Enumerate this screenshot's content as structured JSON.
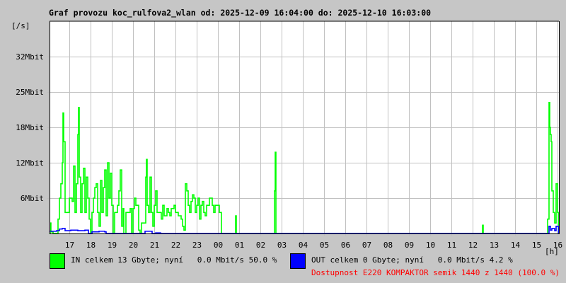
{
  "chart_data": {
    "type": "line",
    "title": "Graf provozu koc_rulfova2_wlan od: 2025-12-09 16:04:00 do: 2025-12-10 16:03:00",
    "ylabel": "[/s]",
    "xlabel": "[h]",
    "start": "2025-12-09 16:04",
    "end": "2025-12-10 16:03",
    "ylim_mbit": [
      0,
      38.4
    ],
    "y_ticks": [
      {
        "value": 6.4,
        "label": "6Mbit"
      },
      {
        "value": 12.8,
        "label": "12Mbit"
      },
      {
        "value": 19.2,
        "label": "18Mbit"
      },
      {
        "value": 25.6,
        "label": "25Mbit"
      },
      {
        "value": 32,
        "label": "32Mbit"
      }
    ],
    "x_ticks": [
      "17",
      "18",
      "19",
      "20",
      "21",
      "22",
      "23",
      "00",
      "01",
      "02",
      "03",
      "04",
      "05",
      "06",
      "07",
      "08",
      "09",
      "10",
      "11",
      "12",
      "13",
      "14",
      "15",
      "16"
    ],
    "grid": true,
    "series": [
      {
        "name": "IN",
        "color": "#00ff00",
        "points": [
          [
            "16:04",
            0
          ],
          [
            "16:06",
            1.9
          ],
          [
            "16:08",
            0.3
          ],
          [
            "16:14",
            0
          ],
          [
            "16:24",
            0
          ],
          [
            "16:28",
            2.6
          ],
          [
            "16:32",
            6.4
          ],
          [
            "16:36",
            9.0
          ],
          [
            "16:40",
            12.8
          ],
          [
            "16:42",
            21.8
          ],
          [
            "16:44",
            16.6
          ],
          [
            "16:48",
            3.8
          ],
          [
            "16:54",
            3.8
          ],
          [
            "17:00",
            6.4
          ],
          [
            "17:08",
            5.8
          ],
          [
            "17:12",
            12.2
          ],
          [
            "17:16",
            3.8
          ],
          [
            "17:20",
            9.0
          ],
          [
            "17:24",
            17.9
          ],
          [
            "17:26",
            22.8
          ],
          [
            "17:28",
            10.2
          ],
          [
            "17:32",
            3.8
          ],
          [
            "17:36",
            9.0
          ],
          [
            "17:40",
            11.8
          ],
          [
            "17:44",
            3.8
          ],
          [
            "17:48",
            10.2
          ],
          [
            "17:52",
            6.4
          ],
          [
            "17:56",
            2.6
          ],
          [
            "18:00",
            0
          ],
          [
            "18:04",
            3.8
          ],
          [
            "18:08",
            6.4
          ],
          [
            "18:12",
            8.3
          ],
          [
            "18:16",
            9.0
          ],
          [
            "18:20",
            3.8
          ],
          [
            "18:24",
            1.3
          ],
          [
            "18:28",
            9.6
          ],
          [
            "18:32",
            3.8
          ],
          [
            "18:36",
            8.3
          ],
          [
            "18:40",
            11.5
          ],
          [
            "18:44",
            3.2
          ],
          [
            "18:48",
            12.8
          ],
          [
            "18:52",
            6.4
          ],
          [
            "18:56",
            10.9
          ],
          [
            "19:00",
            5.1
          ],
          [
            "19:04",
            0
          ],
          [
            "19:08",
            3.8
          ],
          [
            "19:16",
            5.1
          ],
          [
            "19:20",
            7.7
          ],
          [
            "19:24",
            11.5
          ],
          [
            "19:28",
            1.3
          ],
          [
            "19:32",
            4.5
          ],
          [
            "19:34",
            0
          ],
          [
            "19:40",
            3.8
          ],
          [
            "19:48",
            3.8
          ],
          [
            "19:52",
            4.5
          ],
          [
            "19:56",
            0
          ],
          [
            "20:00",
            4.5
          ],
          [
            "20:04",
            6.4
          ],
          [
            "20:08",
            5.1
          ],
          [
            "20:16",
            0.6
          ],
          [
            "20:20",
            0
          ],
          [
            "20:24",
            1.9
          ],
          [
            "20:32",
            1.9
          ],
          [
            "20:36",
            10.2
          ],
          [
            "20:38",
            13.4
          ],
          [
            "20:40",
            5.1
          ],
          [
            "20:44",
            3.8
          ],
          [
            "20:48",
            10.2
          ],
          [
            "20:52",
            3.8
          ],
          [
            "20:56",
            1.3
          ],
          [
            "21:00",
            5.1
          ],
          [
            "21:04",
            7.7
          ],
          [
            "21:08",
            3.8
          ],
          [
            "21:12",
            3.8
          ],
          [
            "21:20",
            2.6
          ],
          [
            "21:24",
            5.1
          ],
          [
            "21:28",
            3.2
          ],
          [
            "21:36",
            4.5
          ],
          [
            "21:40",
            3.8
          ],
          [
            "21:44",
            3.2
          ],
          [
            "21:48",
            4.5
          ],
          [
            "21:56",
            5.1
          ],
          [
            "22:00",
            3.8
          ],
          [
            "22:08",
            3.2
          ],
          [
            "22:16",
            2.6
          ],
          [
            "22:20",
            1.3
          ],
          [
            "22:24",
            0.6
          ],
          [
            "22:28",
            9.0
          ],
          [
            "22:32",
            7.7
          ],
          [
            "22:36",
            5.1
          ],
          [
            "22:40",
            3.8
          ],
          [
            "22:44",
            5.8
          ],
          [
            "22:48",
            7.0
          ],
          [
            "22:52",
            6.4
          ],
          [
            "22:56",
            3.8
          ],
          [
            "23:00",
            5.1
          ],
          [
            "23:04",
            6.4
          ],
          [
            "23:08",
            2.6
          ],
          [
            "23:12",
            5.1
          ],
          [
            "23:16",
            5.8
          ],
          [
            "23:20",
            3.8
          ],
          [
            "23:24",
            3.2
          ],
          [
            "23:28",
            5.1
          ],
          [
            "23:36",
            6.4
          ],
          [
            "23:44",
            5.1
          ],
          [
            "23:48",
            3.8
          ],
          [
            "23:52",
            5.1
          ],
          [
            "23:56",
            5.1
          ],
          [
            "00:00",
            5.1
          ],
          [
            "00:04",
            3.8
          ],
          [
            "00:08",
            3.8
          ],
          [
            "00:10",
            0
          ],
          [
            "00:14",
            0
          ],
          [
            "00:44",
            0
          ],
          [
            "00:50",
            3.2
          ],
          [
            "00:52",
            0
          ],
          [
            "00:54",
            0
          ],
          [
            "02:36",
            0
          ],
          [
            "02:40",
            7.7
          ],
          [
            "02:42",
            14.7
          ],
          [
            "02:44",
            0
          ],
          [
            "12:24",
            0
          ],
          [
            "12:28",
            1.5
          ],
          [
            "12:30",
            0
          ],
          [
            "15:04",
            0
          ],
          [
            "15:28",
            0
          ],
          [
            "15:32",
            2.6
          ],
          [
            "15:36",
            23.7
          ],
          [
            "15:38",
            19.2
          ],
          [
            "15:40",
            17.9
          ],
          [
            "15:42",
            16.6
          ],
          [
            "15:44",
            7.7
          ],
          [
            "15:48",
            3.8
          ],
          [
            "15:52",
            1.9
          ],
          [
            "15:56",
            9.0
          ],
          [
            "16:00",
            3.8
          ],
          [
            "16:03",
            0
          ]
        ]
      },
      {
        "name": "OUT",
        "color": "#0000ff",
        "points": [
          [
            "16:04",
            0.4
          ],
          [
            "16:24",
            0.5
          ],
          [
            "16:32",
            0.8
          ],
          [
            "16:40",
            0.9
          ],
          [
            "16:48",
            0.5
          ],
          [
            "17:04",
            0.6
          ],
          [
            "17:24",
            0.5
          ],
          [
            "17:44",
            0.6
          ],
          [
            "17:54",
            0
          ],
          [
            "18:04",
            0.3
          ],
          [
            "18:24",
            0.4
          ],
          [
            "18:40",
            0.3
          ],
          [
            "18:44",
            0
          ],
          [
            "20:24",
            0
          ],
          [
            "20:34",
            0.4
          ],
          [
            "20:44",
            0.4
          ],
          [
            "20:54",
            0
          ],
          [
            "21:04",
            0.1
          ],
          [
            "21:18",
            0
          ],
          [
            "15:28",
            0
          ],
          [
            "15:36",
            1.3
          ],
          [
            "15:40",
            0.6
          ],
          [
            "15:44",
            0.9
          ],
          [
            "15:52",
            0.5
          ],
          [
            "15:56",
            1.3
          ],
          [
            "16:03",
            0
          ]
        ]
      }
    ]
  },
  "legend": {
    "in": {
      "text": "IN celkem 13 Gbyte; nyní   0.0 Mbit/s 50.0 %",
      "color": "#00ff00"
    },
    "out": {
      "text": "OUT celkem 0 Gbyte; nyní   0.0 Mbit/s 4.2 %",
      "color": "#0000ff"
    },
    "availability": {
      "text": "Dostupnost E220 KOMPAKTOR semik 1440 z 1440 (100.0 %)",
      "color": "#ff0000"
    }
  }
}
